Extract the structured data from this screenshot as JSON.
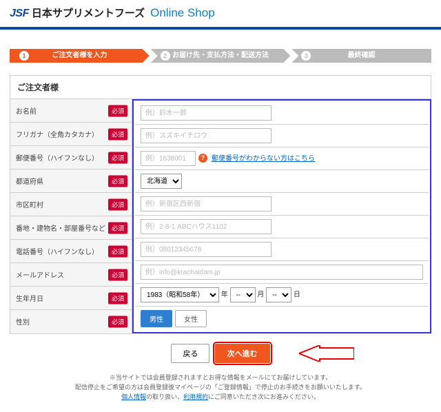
{
  "header": {
    "logo_jsf": "JSF",
    "logo_jp": "日本サプリメントフーズ",
    "logo_shop": "Online Shop"
  },
  "steps": [
    {
      "num": "1",
      "label": "ご注文者様を入力"
    },
    {
      "num": "2",
      "label": "お届け先・支払方法・配送方法"
    },
    {
      "num": "3",
      "label": "最終確認"
    }
  ],
  "section_title": "ご注文者様",
  "badge": "必須",
  "rows": {
    "name": {
      "label": "お名前",
      "ph": "例）鈴木一郎"
    },
    "kana": {
      "label": "フリガナ（全角カタカナ）",
      "ph": "例）スズキイチロウ"
    },
    "zip": {
      "label": "郵便番号（ハイフンなし）",
      "ph": "例）1638001",
      "help": "郵便番号がわからない方はこちら"
    },
    "pref": {
      "label": "都道府県",
      "selected": "北海道"
    },
    "city": {
      "label": "市区町村",
      "ph": "例）新宿区西新宿"
    },
    "addr": {
      "label": "番地・建物名・部屋番号など",
      "ph": "例）2-8-1 ABCハウス1102"
    },
    "tel": {
      "label": "電話番号（ハイフンなし）",
      "ph": "例）08012345678"
    },
    "mail": {
      "label": "メールアドレス",
      "ph": "例）info@krachaidam.jp"
    },
    "birth": {
      "label": "生年月日",
      "year": "1983（昭和58年）",
      "y": "年",
      "m": "月",
      "d": "日",
      "dash": "--"
    },
    "gender": {
      "label": "性別",
      "male": "男性",
      "female": "女性"
    }
  },
  "buttons": {
    "back": "戻る",
    "next": "次へ進む"
  },
  "footer": {
    "l1": "※当サイトでは会員登録されますとお得な情報をメールにてお届けしています。",
    "l2": "配信停止をご希望の方は会員登録後マイページの「ご登録情報」で停止のお手続きをお願いいたします。",
    "l3a": "個人情報",
    "l3b": "の取り扱い、",
    "l3c": "利用規約",
    "l3d": "にご同意いただき次にお進みください。"
  }
}
